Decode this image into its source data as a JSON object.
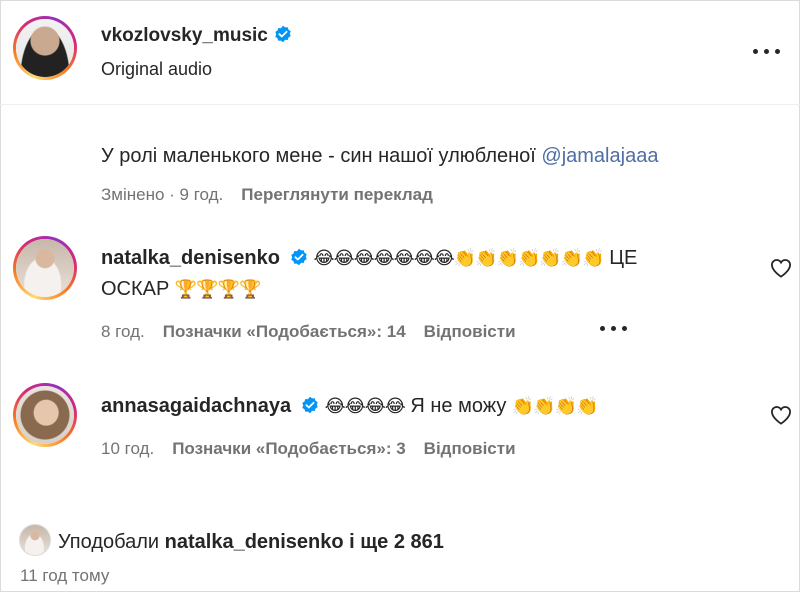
{
  "post": {
    "username": "vkozlovsky_music",
    "audio": "Original audio",
    "caption_text": "У ролі маленького мене - син нашої улюбленої",
    "caption_mention": "@jamalajaaa",
    "edited": "Змінено · 9 год.",
    "see_translation": "Переглянути переклад"
  },
  "comments": [
    {
      "username": "natalka_denisenko",
      "emojis": "😂😂😂😂😂😂😂👏👏👏👏👏👏👏",
      "text_line1": "ЦЕ",
      "text_line2": "ОСКАР",
      "trophies": "🏆🏆🏆🏆",
      "time": "8 год.",
      "likes": "Позначки «Подобається»: 14",
      "reply": "Відповісти"
    },
    {
      "username": "annasagaidachnaya",
      "emojis": "😂😂😂😂",
      "text": "Я не можу",
      "claps": "👏👏👏👏",
      "time": "10 год.",
      "likes": "Позначки «Подобається»: 3",
      "reply": "Відповісти"
    }
  ],
  "footer": {
    "liked_prefix": "Уподобали",
    "liked_user": "natalka_denisenko",
    "liked_suffix": "і ще 2 861",
    "time": "11 год тому"
  },
  "colors": {
    "text": "#262626",
    "secondary": "#737373",
    "mention": "#4f6ea5",
    "verified": "#0095f6"
  },
  "icons": {
    "verified": "verified-badge-icon",
    "more": "more-options-icon",
    "like": "heart-outline-icon"
  }
}
